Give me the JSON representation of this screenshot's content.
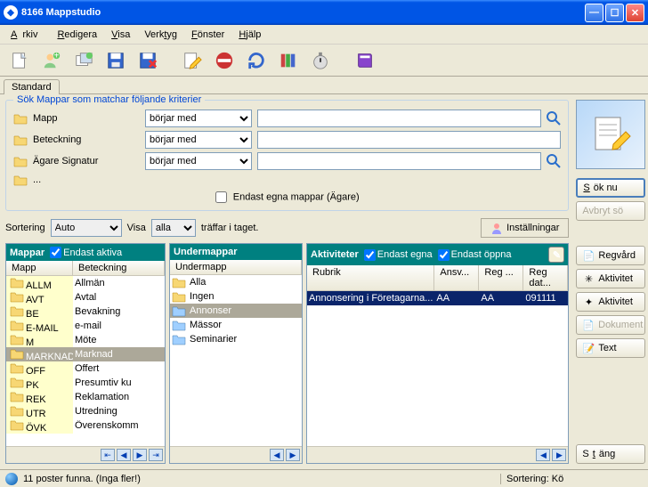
{
  "window": {
    "title": "8166 Mappstudio"
  },
  "menu": {
    "arkiv": "Arkiv",
    "redigera": "Redigera",
    "visa": "Visa",
    "verktyg": "Verktyg",
    "fonster": "Fönster",
    "hjalp": "Hjälp"
  },
  "tab": {
    "standard": "Standard"
  },
  "search": {
    "legend": "Sök  Mappar som matchar följande kriterier",
    "rows": {
      "mapp": {
        "label": "Mapp",
        "op": "börjar med",
        "value": ""
      },
      "beteckning": {
        "label": "Beteckning",
        "op": "börjar med",
        "value": ""
      },
      "agare": {
        "label": "Ägare Signatur",
        "op": "börjar med",
        "value": ""
      },
      "more": {
        "label": "..."
      }
    },
    "only_own_label": "Endast egna mappar (Ägare)"
  },
  "sort": {
    "label": "Sortering",
    "value": "Auto",
    "visa_label": "Visa",
    "visa_value": "alla",
    "suffix": "träffar i taget.",
    "settings": "Inställningar"
  },
  "panels": {
    "mappar": {
      "title": "Mappar",
      "chk": "Endast aktiva",
      "cols": {
        "c1": "Mapp",
        "c2": "Beteckning"
      },
      "rows": [
        {
          "code": "ALLM",
          "name": "Allmän"
        },
        {
          "code": "AVT",
          "name": "Avtal"
        },
        {
          "code": "BE",
          "name": "Bevakning"
        },
        {
          "code": "E-MAIL",
          "name": "e-mail"
        },
        {
          "code": "M",
          "name": "Möte"
        },
        {
          "code": "MARKNAD",
          "name": "Marknad",
          "selected": true
        },
        {
          "code": "OFF",
          "name": "Offert"
        },
        {
          "code": "PK",
          "name": "Presumtiv ku"
        },
        {
          "code": "REK",
          "name": "Reklamation"
        },
        {
          "code": "UTR",
          "name": "Utredning"
        },
        {
          "code": "ÖVK",
          "name": "Överenskomm"
        }
      ]
    },
    "under": {
      "title": "Undermappar",
      "col": "Undermapp",
      "rows": [
        {
          "name": "Alla"
        },
        {
          "name": "Ingen"
        },
        {
          "name": "Annonser",
          "selected": true
        },
        {
          "name": "Mässor"
        },
        {
          "name": "Seminarier"
        }
      ]
    },
    "aktiv": {
      "title": "Aktiviteter",
      "chk1": "Endast egna",
      "chk2": "Endast öppna",
      "cols": {
        "c1": "Rubrik",
        "c2": "Ansv...",
        "c3": "Reg ...",
        "c4": "Reg dat..."
      },
      "rows": [
        {
          "rubrik": "Annonsering i Företagarna...",
          "ansv": "AA",
          "reg": "AA",
          "dat": "091111"
        }
      ]
    }
  },
  "right": {
    "sok": "Sök nu",
    "avbryt": "Avbryt sö",
    "regvard": "Regvård",
    "akt1": "Aktivitet",
    "akt2": "Aktivitet",
    "dok": "Dokument",
    "text": "Text",
    "stang": "Stäng"
  },
  "status": {
    "text": "11 poster funna. (Inga fler!)",
    "sort": "Sortering: Kö"
  }
}
